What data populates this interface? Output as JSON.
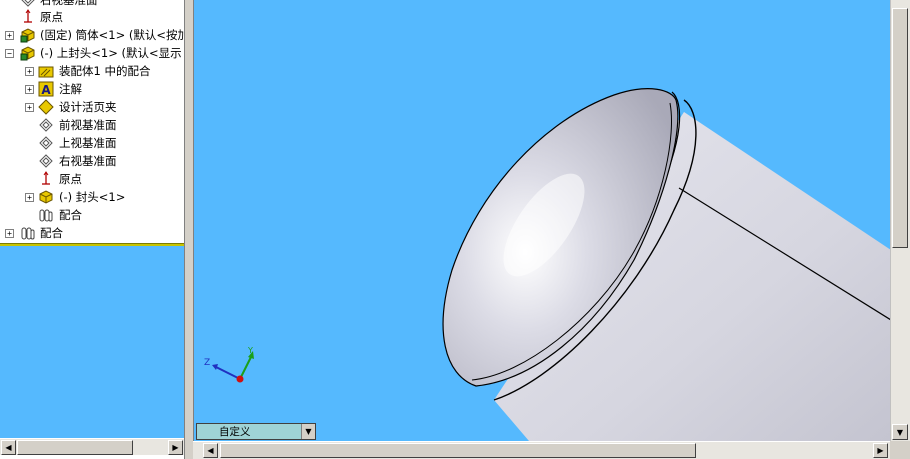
{
  "tree": {
    "items": [
      {
        "label": "右视基准面",
        "icon": "plane-icon",
        "indent": 0,
        "expander": ""
      },
      {
        "label": "原点",
        "icon": "origin-icon",
        "indent": 0,
        "expander": ""
      },
      {
        "label": "(固定) 筒体<1> (默认<按加",
        "icon": "part-icon",
        "indent": 0,
        "expander": "+"
      },
      {
        "label": "(-) 上封头<1> (默认<显示",
        "icon": "subassembly-icon",
        "indent": 0,
        "expander": "−"
      },
      {
        "label": "装配体1 中的配合",
        "icon": "mates-folder-icon",
        "indent": 1,
        "expander": "+"
      },
      {
        "label": "注解",
        "icon": "annotations-icon",
        "indent": 1,
        "expander": "+"
      },
      {
        "label": "设计活页夹",
        "icon": "design-binder-icon",
        "indent": 1,
        "expander": "+"
      },
      {
        "label": "前视基准面",
        "icon": "plane-icon",
        "indent": 1,
        "expander": ""
      },
      {
        "label": "上视基准面",
        "icon": "plane-icon",
        "indent": 1,
        "expander": ""
      },
      {
        "label": "右视基准面",
        "icon": "plane-icon",
        "indent": 1,
        "expander": ""
      },
      {
        "label": "原点",
        "icon": "origin-icon",
        "indent": 1,
        "expander": ""
      },
      {
        "label": "(-) 封头<1>",
        "icon": "part-icon",
        "indent": 1,
        "expander": "+"
      },
      {
        "label": "配合",
        "icon": "mates-icon",
        "indent": 1,
        "expander": ""
      },
      {
        "label": "配合",
        "icon": "mates-icon",
        "indent": 0,
        "expander": "+"
      }
    ]
  },
  "viewport": {
    "background_color": "#55b9fe",
    "triad": {
      "x_label": "Z",
      "y_label": "Y"
    }
  },
  "config_tab": {
    "value": "自定义"
  },
  "colors": {
    "accent_divider": "#c8c400",
    "model_gray": "#dcdce6"
  }
}
